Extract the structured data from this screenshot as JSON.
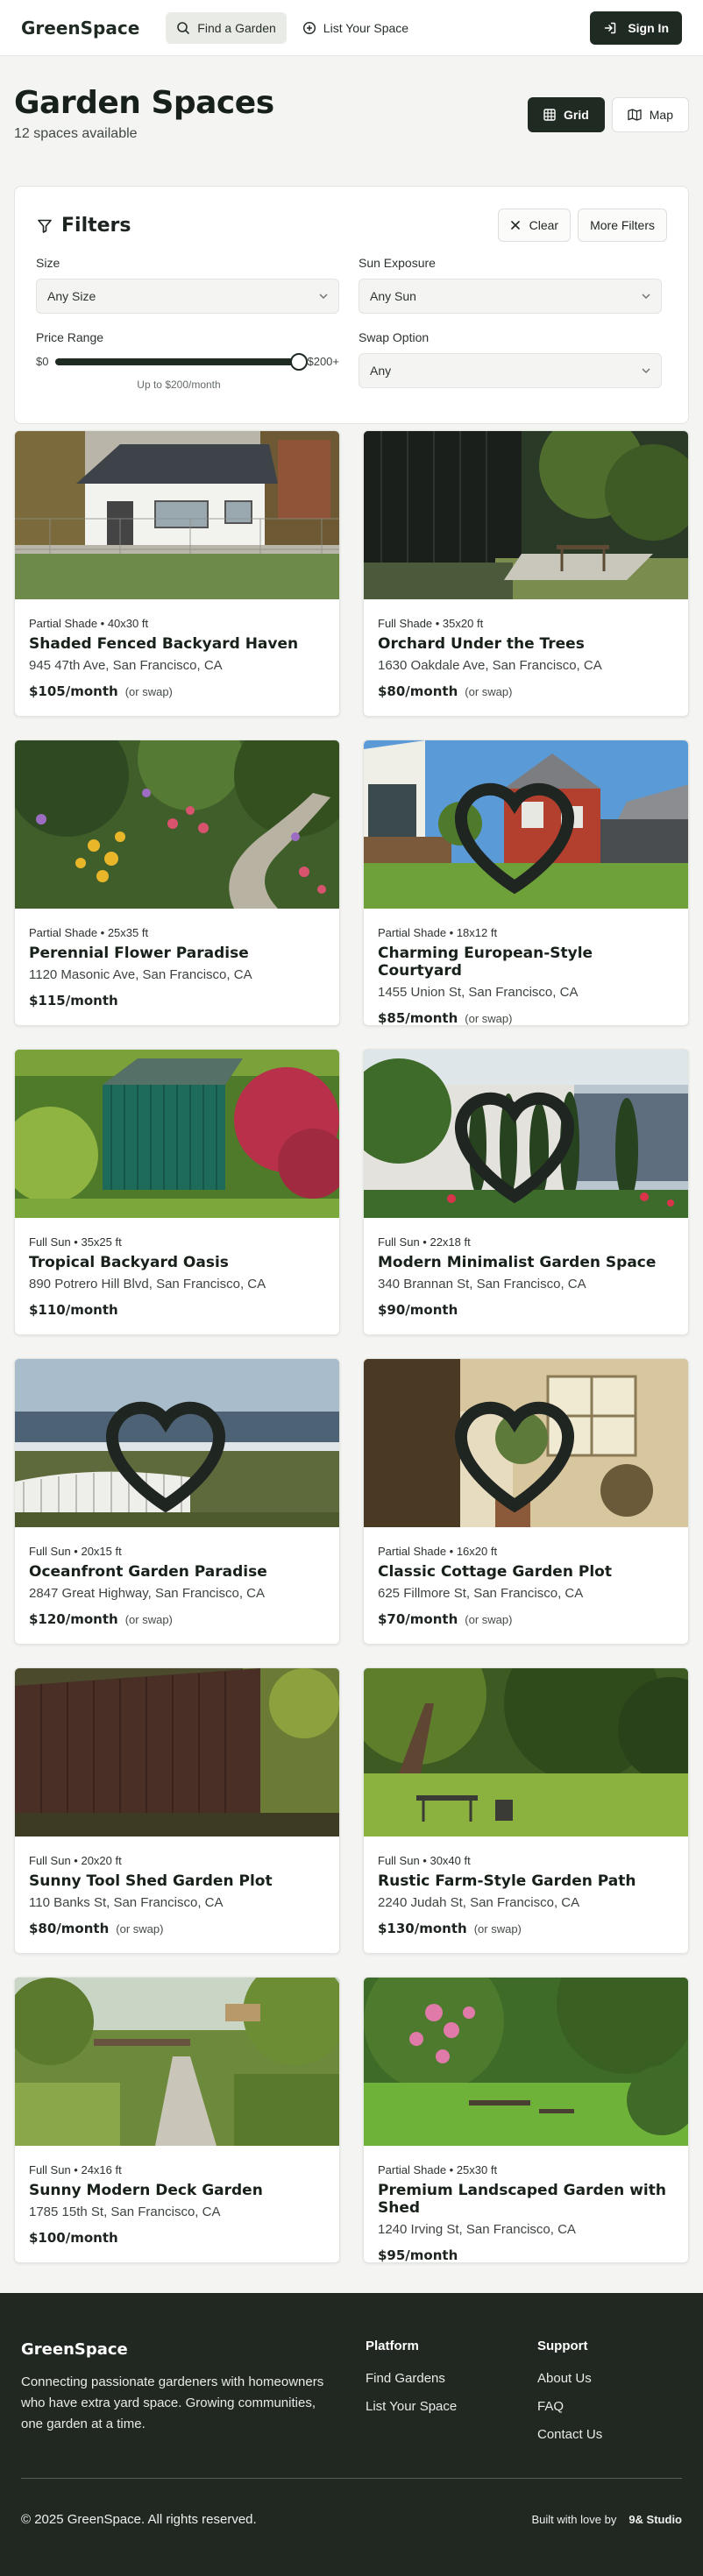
{
  "nav": {
    "brand": "GreenSpace",
    "find_label": "Find a Garden",
    "list_label": "List Your Space",
    "signin_label": "Sign In"
  },
  "header": {
    "title": "Garden Spaces",
    "count": "12 spaces available",
    "grid_label": "Grid",
    "map_label": "Map"
  },
  "filters": {
    "title": "Filters",
    "clear_label": "Clear",
    "more_label": "More Filters",
    "size": {
      "label": "Size",
      "value": "Any Size"
    },
    "sun": {
      "label": "Sun Exposure",
      "value": "Any Sun"
    },
    "price": {
      "label": "Price Range",
      "min": "$0",
      "max": "$200+",
      "note": "Up to $200/month",
      "level_percent": 100
    },
    "swap": {
      "label": "Swap Option",
      "value": "Any"
    }
  },
  "listings": [
    {
      "meta": "Partial Shade • 40x30 ft",
      "name": "Shaded Fenced Backyard Haven",
      "address": "945 47th Ave, San Francisco, CA",
      "price": "$105/month",
      "swap": "(or swap)"
    },
    {
      "meta": "Full Shade • 35x20 ft",
      "name": "Orchard Under the Trees",
      "address": "1630 Oakdale Ave, San Francisco, CA",
      "price": "$80/month",
      "swap": "(or swap)"
    },
    {
      "meta": "Partial Shade • 25x35 ft",
      "name": "Perennial Flower Paradise",
      "address": "1120 Masonic Ave, San Francisco, CA",
      "price": "$115/month",
      "swap": ""
    },
    {
      "meta": "Partial Shade • 18x12 ft",
      "name": "Charming European-Style Courtyard",
      "address": "1455 Union St, San Francisco, CA",
      "price": "$85/month",
      "swap": "(or swap)"
    },
    {
      "meta": "Full Sun • 35x25 ft",
      "name": "Tropical Backyard Oasis",
      "address": "890 Potrero Hill Blvd, San Francisco, CA",
      "price": "$110/month",
      "swap": ""
    },
    {
      "meta": "Full Sun • 22x18 ft",
      "name": "Modern Minimalist Garden Space",
      "address": "340 Brannan St, San Francisco, CA",
      "price": "$90/month",
      "swap": ""
    },
    {
      "meta": "Full Sun • 20x15 ft",
      "name": "Oceanfront Garden Paradise",
      "address": "2847 Great Highway, San Francisco, CA",
      "price": "$120/month",
      "swap": "(or swap)"
    },
    {
      "meta": "Partial Shade • 16x20 ft",
      "name": "Classic Cottage Garden Plot",
      "address": "625 Fillmore St, San Francisco, CA",
      "price": "$70/month",
      "swap": "(or swap)"
    },
    {
      "meta": "Full Sun • 20x20 ft",
      "name": "Sunny Tool Shed Garden Plot",
      "address": "110 Banks St, San Francisco, CA",
      "price": "$80/month",
      "swap": "(or swap)"
    },
    {
      "meta": "Full Sun • 30x40 ft",
      "name": "Rustic Farm-Style Garden Path",
      "address": "2240 Judah St, San Francisco, CA",
      "price": "$130/month",
      "swap": "(or swap)"
    },
    {
      "meta": "Full Sun • 24x16 ft",
      "name": "Sunny Modern Deck Garden",
      "address": "1785 15th St, San Francisco, CA",
      "price": "$100/month",
      "swap": ""
    },
    {
      "meta": "Partial Shade • 25x30 ft",
      "name": "Premium Landscaped Garden with Shed",
      "address": "1240 Irving St, San Francisco, CA",
      "price": "$95/month",
      "swap": ""
    }
  ],
  "footer": {
    "brand": "GreenSpace",
    "description": "Connecting passionate gardeners with homeowners who have extra yard space. Growing communities, one garden at a time.",
    "platform_heading": "Platform",
    "platform_links": [
      "Find Gardens",
      "List Your Space"
    ],
    "support_heading": "Support",
    "support_links": [
      "About Us",
      "FAQ",
      "Contact Us"
    ],
    "copyright": "© 2025 GreenSpace. All rights reserved.",
    "built_prefix": "Built with love by",
    "built_by": "9& Studio"
  }
}
